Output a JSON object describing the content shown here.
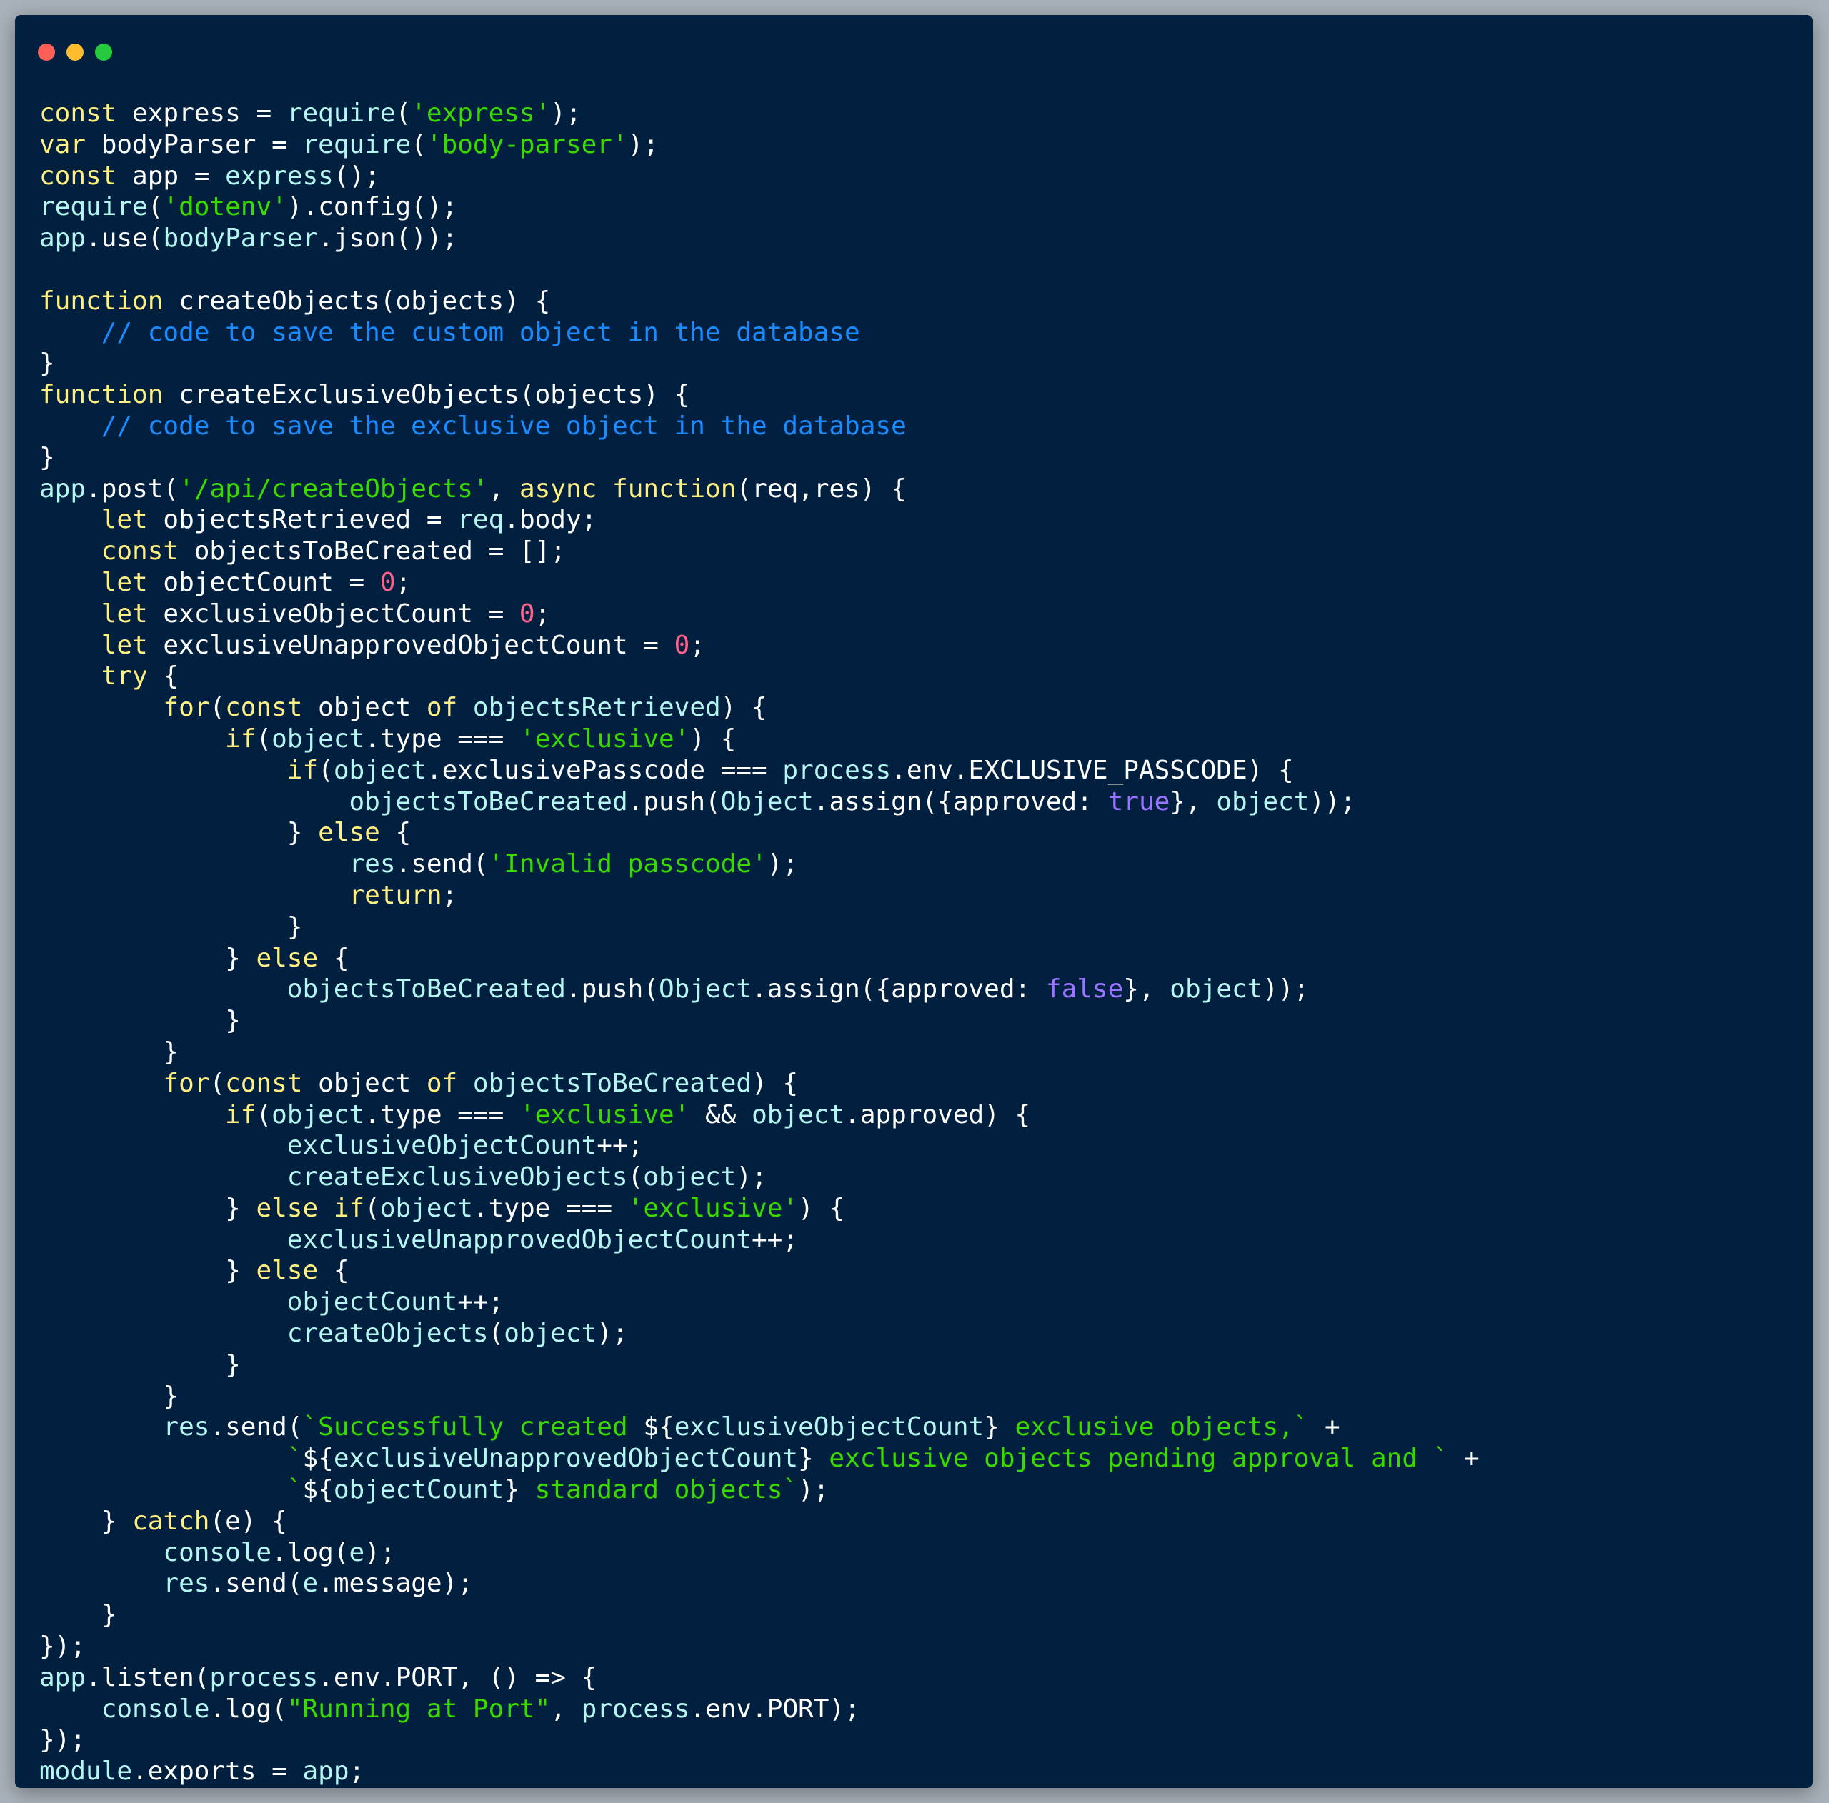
{
  "window": {
    "controls": [
      {
        "name": "close",
        "color": "#ff5f56"
      },
      {
        "name": "minimize",
        "color": "#ffbd2e"
      },
      {
        "name": "maximize",
        "color": "#27c93f"
      }
    ]
  },
  "colors": {
    "background": "#01203f",
    "keyword": "#ffee80",
    "function": "#b5f5f2",
    "string": "#3ad900",
    "number": "#ff628c",
    "boolean": "#9a73ff",
    "comment": "#1a8aff",
    "text": "#ffffff"
  },
  "code": {
    "language": "javascript",
    "lines": [
      [
        [
          "kw",
          "const"
        ],
        [
          "id",
          " express "
        ],
        [
          "op",
          "= "
        ],
        [
          "fn",
          "require"
        ],
        [
          "op",
          "("
        ],
        [
          "str",
          "'express'"
        ],
        [
          "op",
          ");"
        ]
      ],
      [
        [
          "kw",
          "var"
        ],
        [
          "id",
          " bodyParser "
        ],
        [
          "op",
          "= "
        ],
        [
          "fn",
          "require"
        ],
        [
          "op",
          "("
        ],
        [
          "str",
          "'body-parser'"
        ],
        [
          "op",
          ");"
        ]
      ],
      [
        [
          "kw",
          "const"
        ],
        [
          "id",
          " app "
        ],
        [
          "op",
          "= "
        ],
        [
          "fn",
          "express"
        ],
        [
          "op",
          "();"
        ]
      ],
      [
        [
          "fn",
          "require"
        ],
        [
          "op",
          "("
        ],
        [
          "str",
          "'dotenv'"
        ],
        [
          "op",
          ")."
        ],
        [
          "id",
          "config"
        ],
        [
          "op",
          "();"
        ]
      ],
      [
        [
          "fn",
          "app"
        ],
        [
          "op",
          "."
        ],
        [
          "id",
          "use"
        ],
        [
          "op",
          "("
        ],
        [
          "fn",
          "bodyParser"
        ],
        [
          "op",
          "."
        ],
        [
          "id",
          "json"
        ],
        [
          "op",
          "());"
        ]
      ],
      [
        [
          "id",
          ""
        ]
      ],
      [
        [
          "kw",
          "function"
        ],
        [
          "id",
          " createObjects"
        ],
        [
          "op",
          "("
        ],
        [
          "id",
          "objects"
        ],
        [
          "op",
          ") {"
        ]
      ],
      [
        [
          "id",
          "    "
        ],
        [
          "cm",
          "// code to save the custom object in the database"
        ]
      ],
      [
        [
          "op",
          "}"
        ]
      ],
      [
        [
          "kw",
          "function"
        ],
        [
          "id",
          " createExclusiveObjects"
        ],
        [
          "op",
          "("
        ],
        [
          "id",
          "objects"
        ],
        [
          "op",
          ") {"
        ]
      ],
      [
        [
          "id",
          "    "
        ],
        [
          "cm",
          "// code to save the exclusive object in the database"
        ]
      ],
      [
        [
          "op",
          "}"
        ]
      ],
      [
        [
          "fn",
          "app"
        ],
        [
          "op",
          "."
        ],
        [
          "id",
          "post"
        ],
        [
          "op",
          "("
        ],
        [
          "str",
          "'/api/createObjects'"
        ],
        [
          "op",
          ", "
        ],
        [
          "kw",
          "async"
        ],
        [
          "id",
          " "
        ],
        [
          "kw",
          "function"
        ],
        [
          "op",
          "("
        ],
        [
          "id",
          "req"
        ],
        [
          "op",
          ","
        ],
        [
          "id",
          "res"
        ],
        [
          "op",
          ") {"
        ]
      ],
      [
        [
          "id",
          "    "
        ],
        [
          "kw",
          "let"
        ],
        [
          "id",
          " objectsRetrieved "
        ],
        [
          "op",
          "= "
        ],
        [
          "fn",
          "req"
        ],
        [
          "op",
          "."
        ],
        [
          "id",
          "body"
        ],
        [
          "op",
          ";"
        ]
      ],
      [
        [
          "id",
          "    "
        ],
        [
          "kw",
          "const"
        ],
        [
          "id",
          " objectsToBeCreated "
        ],
        [
          "op",
          "= [];"
        ]
      ],
      [
        [
          "id",
          "    "
        ],
        [
          "kw",
          "let"
        ],
        [
          "id",
          " objectCount "
        ],
        [
          "op",
          "= "
        ],
        [
          "num",
          "0"
        ],
        [
          "op",
          ";"
        ]
      ],
      [
        [
          "id",
          "    "
        ],
        [
          "kw",
          "let"
        ],
        [
          "id",
          " exclusiveObjectCount "
        ],
        [
          "op",
          "= "
        ],
        [
          "num",
          "0"
        ],
        [
          "op",
          ";"
        ]
      ],
      [
        [
          "id",
          "    "
        ],
        [
          "kw",
          "let"
        ],
        [
          "id",
          " exclusiveUnapprovedObjectCount "
        ],
        [
          "op",
          "= "
        ],
        [
          "num",
          "0"
        ],
        [
          "op",
          ";"
        ]
      ],
      [
        [
          "id",
          "    "
        ],
        [
          "kw",
          "try"
        ],
        [
          "op",
          " {"
        ]
      ],
      [
        [
          "id",
          "        "
        ],
        [
          "kw",
          "for"
        ],
        [
          "op",
          "("
        ],
        [
          "kw",
          "const"
        ],
        [
          "id",
          " object "
        ],
        [
          "kw",
          "of"
        ],
        [
          "id",
          " "
        ],
        [
          "fn",
          "objectsRetrieved"
        ],
        [
          "op",
          ") {"
        ]
      ],
      [
        [
          "id",
          "            "
        ],
        [
          "kw",
          "if"
        ],
        [
          "op",
          "("
        ],
        [
          "fn",
          "object"
        ],
        [
          "op",
          "."
        ],
        [
          "id",
          "type"
        ],
        [
          "op",
          " === "
        ],
        [
          "str",
          "'exclusive'"
        ],
        [
          "op",
          ") {"
        ]
      ],
      [
        [
          "id",
          "                "
        ],
        [
          "kw",
          "if"
        ],
        [
          "op",
          "("
        ],
        [
          "fn",
          "object"
        ],
        [
          "op",
          "."
        ],
        [
          "id",
          "exclusivePasscode"
        ],
        [
          "op",
          " === "
        ],
        [
          "fn",
          "process"
        ],
        [
          "op",
          "."
        ],
        [
          "id",
          "env"
        ],
        [
          "op",
          "."
        ],
        [
          "id",
          "EXCLUSIVE_PASSCODE"
        ],
        [
          "op",
          ") {"
        ]
      ],
      [
        [
          "id",
          "                    "
        ],
        [
          "fn",
          "objectsToBeCreated"
        ],
        [
          "op",
          "."
        ],
        [
          "id",
          "push"
        ],
        [
          "op",
          "("
        ],
        [
          "fn",
          "Object"
        ],
        [
          "op",
          "."
        ],
        [
          "id",
          "assign"
        ],
        [
          "op",
          "({"
        ],
        [
          "id",
          "approved"
        ],
        [
          "op",
          ": "
        ],
        [
          "bool",
          "true"
        ],
        [
          "op",
          "}, "
        ],
        [
          "fn",
          "object"
        ],
        [
          "op",
          "));"
        ]
      ],
      [
        [
          "id",
          "                "
        ],
        [
          "op",
          "} "
        ],
        [
          "kw",
          "else"
        ],
        [
          "op",
          " {"
        ]
      ],
      [
        [
          "id",
          "                    "
        ],
        [
          "fn",
          "res"
        ],
        [
          "op",
          "."
        ],
        [
          "id",
          "send"
        ],
        [
          "op",
          "("
        ],
        [
          "str",
          "'Invalid passcode'"
        ],
        [
          "op",
          ");"
        ]
      ],
      [
        [
          "id",
          "                    "
        ],
        [
          "kw",
          "return"
        ],
        [
          "op",
          ";"
        ]
      ],
      [
        [
          "id",
          "                "
        ],
        [
          "op",
          "}"
        ]
      ],
      [
        [
          "id",
          "            "
        ],
        [
          "op",
          "} "
        ],
        [
          "kw",
          "else"
        ],
        [
          "op",
          " {"
        ]
      ],
      [
        [
          "id",
          "                "
        ],
        [
          "fn",
          "objectsToBeCreated"
        ],
        [
          "op",
          "."
        ],
        [
          "id",
          "push"
        ],
        [
          "op",
          "("
        ],
        [
          "fn",
          "Object"
        ],
        [
          "op",
          "."
        ],
        [
          "id",
          "assign"
        ],
        [
          "op",
          "({"
        ],
        [
          "id",
          "approved"
        ],
        [
          "op",
          ": "
        ],
        [
          "bool",
          "false"
        ],
        [
          "op",
          "}, "
        ],
        [
          "fn",
          "object"
        ],
        [
          "op",
          "));"
        ]
      ],
      [
        [
          "id",
          "            "
        ],
        [
          "op",
          "}"
        ]
      ],
      [
        [
          "id",
          "        "
        ],
        [
          "op",
          "}"
        ]
      ],
      [
        [
          "id",
          "        "
        ],
        [
          "kw",
          "for"
        ],
        [
          "op",
          "("
        ],
        [
          "kw",
          "const"
        ],
        [
          "id",
          " object "
        ],
        [
          "kw",
          "of"
        ],
        [
          "id",
          " "
        ],
        [
          "fn",
          "objectsToBeCreated"
        ],
        [
          "op",
          ") {"
        ]
      ],
      [
        [
          "id",
          "            "
        ],
        [
          "kw",
          "if"
        ],
        [
          "op",
          "("
        ],
        [
          "fn",
          "object"
        ],
        [
          "op",
          "."
        ],
        [
          "id",
          "type"
        ],
        [
          "op",
          " === "
        ],
        [
          "str",
          "'exclusive'"
        ],
        [
          "op",
          " && "
        ],
        [
          "fn",
          "object"
        ],
        [
          "op",
          "."
        ],
        [
          "id",
          "approved"
        ],
        [
          "op",
          ") {"
        ]
      ],
      [
        [
          "id",
          "                "
        ],
        [
          "fn",
          "exclusiveObjectCount"
        ],
        [
          "op",
          "++;"
        ]
      ],
      [
        [
          "id",
          "                "
        ],
        [
          "fn",
          "createExclusiveObjects"
        ],
        [
          "op",
          "("
        ],
        [
          "fn",
          "object"
        ],
        [
          "op",
          ");"
        ]
      ],
      [
        [
          "id",
          "            "
        ],
        [
          "op",
          "} "
        ],
        [
          "kw",
          "else if"
        ],
        [
          "op",
          "("
        ],
        [
          "fn",
          "object"
        ],
        [
          "op",
          "."
        ],
        [
          "id",
          "type"
        ],
        [
          "op",
          " === "
        ],
        [
          "str",
          "'exclusive'"
        ],
        [
          "op",
          ") {"
        ]
      ],
      [
        [
          "id",
          "                "
        ],
        [
          "fn",
          "exclusiveUnapprovedObjectCount"
        ],
        [
          "op",
          "++;"
        ]
      ],
      [
        [
          "id",
          "            "
        ],
        [
          "op",
          "} "
        ],
        [
          "kw",
          "else"
        ],
        [
          "op",
          " {"
        ]
      ],
      [
        [
          "id",
          "                "
        ],
        [
          "fn",
          "objectCount"
        ],
        [
          "op",
          "++;"
        ]
      ],
      [
        [
          "id",
          "                "
        ],
        [
          "fn",
          "createObjects"
        ],
        [
          "op",
          "("
        ],
        [
          "fn",
          "object"
        ],
        [
          "op",
          ");"
        ]
      ],
      [
        [
          "id",
          "            "
        ],
        [
          "op",
          "}"
        ]
      ],
      [
        [
          "id",
          "        "
        ],
        [
          "op",
          "}"
        ]
      ],
      [
        [
          "id",
          "        "
        ],
        [
          "fn",
          "res"
        ],
        [
          "op",
          "."
        ],
        [
          "id",
          "send"
        ],
        [
          "op",
          "("
        ],
        [
          "str",
          "`Successfully created "
        ],
        [
          "op",
          "${"
        ],
        [
          "fn",
          "exclusiveObjectCount"
        ],
        [
          "op",
          "}"
        ],
        [
          "str",
          " exclusive objects,`"
        ],
        [
          "op",
          " +"
        ]
      ],
      [
        [
          "id",
          "                "
        ],
        [
          "str",
          "`"
        ],
        [
          "op",
          "${"
        ],
        [
          "fn",
          "exclusiveUnapprovedObjectCount"
        ],
        [
          "op",
          "}"
        ],
        [
          "str",
          " exclusive objects pending approval and `"
        ],
        [
          "op",
          " +"
        ]
      ],
      [
        [
          "id",
          "                "
        ],
        [
          "str",
          "`"
        ],
        [
          "op",
          "${"
        ],
        [
          "fn",
          "objectCount"
        ],
        [
          "op",
          "}"
        ],
        [
          "str",
          " standard objects`"
        ],
        [
          "op",
          ");"
        ]
      ],
      [
        [
          "id",
          "    "
        ],
        [
          "op",
          "} "
        ],
        [
          "kw",
          "catch"
        ],
        [
          "op",
          "("
        ],
        [
          "id",
          "e"
        ],
        [
          "op",
          ") {"
        ]
      ],
      [
        [
          "id",
          "        "
        ],
        [
          "fn",
          "console"
        ],
        [
          "op",
          "."
        ],
        [
          "id",
          "log"
        ],
        [
          "op",
          "("
        ],
        [
          "fn",
          "e"
        ],
        [
          "op",
          ");"
        ]
      ],
      [
        [
          "id",
          "        "
        ],
        [
          "fn",
          "res"
        ],
        [
          "op",
          "."
        ],
        [
          "id",
          "send"
        ],
        [
          "op",
          "("
        ],
        [
          "fn",
          "e"
        ],
        [
          "op",
          "."
        ],
        [
          "id",
          "message"
        ],
        [
          "op",
          ");"
        ]
      ],
      [
        [
          "id",
          "    "
        ],
        [
          "op",
          "}"
        ]
      ],
      [
        [
          "op",
          "});"
        ]
      ],
      [
        [
          "fn",
          "app"
        ],
        [
          "op",
          "."
        ],
        [
          "id",
          "listen"
        ],
        [
          "op",
          "("
        ],
        [
          "fn",
          "process"
        ],
        [
          "op",
          "."
        ],
        [
          "id",
          "env"
        ],
        [
          "op",
          "."
        ],
        [
          "id",
          "PORT"
        ],
        [
          "op",
          ", () => {"
        ]
      ],
      [
        [
          "id",
          "    "
        ],
        [
          "fn",
          "console"
        ],
        [
          "op",
          "."
        ],
        [
          "id",
          "log"
        ],
        [
          "op",
          "("
        ],
        [
          "str",
          "\"Running at Port\""
        ],
        [
          "op",
          ", "
        ],
        [
          "fn",
          "process"
        ],
        [
          "op",
          "."
        ],
        [
          "id",
          "env"
        ],
        [
          "op",
          "."
        ],
        [
          "id",
          "PORT"
        ],
        [
          "op",
          ");"
        ]
      ],
      [
        [
          "op",
          "});"
        ]
      ],
      [
        [
          "fn",
          "module"
        ],
        [
          "op",
          "."
        ],
        [
          "id",
          "exports"
        ],
        [
          "op",
          " = "
        ],
        [
          "fn",
          "app"
        ],
        [
          "op",
          ";"
        ]
      ]
    ]
  }
}
